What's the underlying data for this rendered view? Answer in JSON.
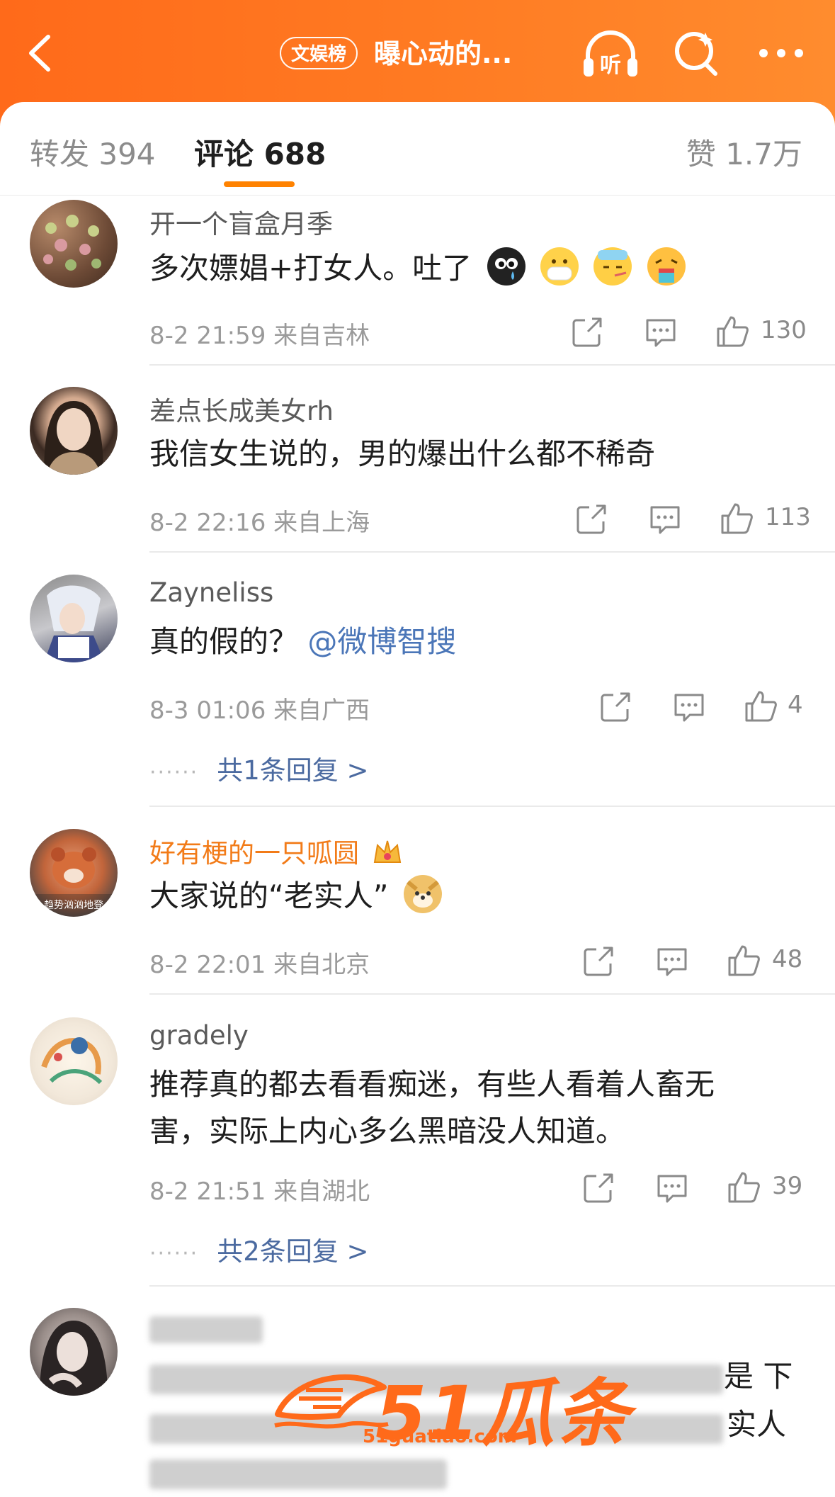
{
  "header": {
    "badge": "文娱榜",
    "title": "曝心动的...",
    "icons": [
      "back-icon",
      "listen-icon",
      "search-icon",
      "more-icon"
    ],
    "listen_label": "听",
    "gradient": [
      "#ff6a1a",
      "#ff8c2e"
    ]
  },
  "tabs": {
    "repost": "转发 394",
    "comment": "评论 688",
    "likes": "赞 1.7万",
    "accent": "#ff8200"
  },
  "comments": [
    {
      "user": "开一个盲盒月季",
      "text": "多次嫖娼+打女人。吐了",
      "time": "8-2 21:59",
      "location": "来自吉林",
      "likes": "130",
      "emojis": [
        "sad-emoji",
        "mask-emoji",
        "sick-emoji",
        "vomit-emoji"
      ]
    },
    {
      "user": "差点长成美女rh",
      "text": "我信女生说的，男的爆出什么都不稀奇",
      "time": "8-2 22:16",
      "location": "来自上海",
      "likes": "113"
    },
    {
      "user": "Zayneliss",
      "text": "真的假的？",
      "mention": "@微博智搜",
      "time": "8-3 01:06",
      "location": "来自广西",
      "likes": "4",
      "replies": "共1条回复 >"
    },
    {
      "user": "好有梗的一只呱圆",
      "text": "大家说的“老实人”",
      "time": "8-2 22:01",
      "location": "来自北京",
      "likes": "48",
      "badge": "crown-icon",
      "emojis": [
        "doge-emoji"
      ],
      "avatar_text": "趋势汹汹地登"
    },
    {
      "user": "gradely",
      "text_line1": "推荐真的都去看看痴迷，有些人看着人畜无",
      "text_line2": "害，实际上内心多么黑暗没人知道。",
      "time": "8-2 21:51",
      "location": "来自湖北",
      "likes": "39",
      "replies": "共2条回复 >"
    },
    {
      "partial_text_a": "是 下",
      "partial_text_b": "实人"
    }
  ],
  "watermark": {
    "brand": "51瓜条",
    "url": "51guatiao.com"
  },
  "colors": {
    "vip_name": "#f27b18",
    "mention": "#4b76b8",
    "reply_link": "#4b6aa0"
  }
}
